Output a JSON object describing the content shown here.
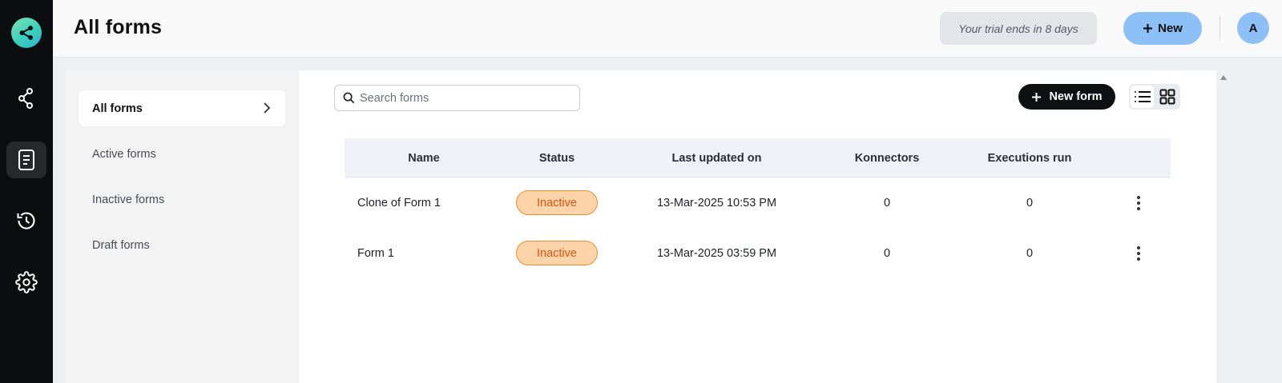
{
  "app": {
    "logo_icon": "share-network-icon"
  },
  "rail": {
    "items": [
      {
        "name": "integrations",
        "icon": "share-network-icon",
        "active": false
      },
      {
        "name": "forms",
        "icon": "document-icon",
        "active": true
      },
      {
        "name": "history",
        "icon": "history-icon",
        "active": false
      },
      {
        "name": "settings",
        "icon": "gear-icon",
        "active": false
      }
    ]
  },
  "header": {
    "title": "All forms",
    "trial_text": "Your trial ends in 8 days",
    "new_label": "New",
    "avatar_initial": "A"
  },
  "subnav": {
    "items": [
      {
        "label": "All forms",
        "active": true
      },
      {
        "label": "Active forms",
        "active": false
      },
      {
        "label": "Inactive forms",
        "active": false
      },
      {
        "label": "Draft forms",
        "active": false
      }
    ]
  },
  "main": {
    "search_placeholder": "Search forms",
    "new_form_label": "New form",
    "view_mode": "list",
    "columns": [
      "Name",
      "Status",
      "Last updated on",
      "Konnectors",
      "Executions run"
    ],
    "rows": [
      {
        "name": "Clone of Form 1",
        "status": "Inactive",
        "updated": "13-Mar-2025 10:53 PM",
        "konnectors": "0",
        "executions": "0"
      },
      {
        "name": "Form 1",
        "status": "Inactive",
        "updated": "13-Mar-2025 03:59 PM",
        "konnectors": "0",
        "executions": "0"
      }
    ]
  },
  "colors": {
    "accent_blue": "#8dc0f7",
    "badge_bg": "#fdd3a9",
    "badge_text": "#d9540f",
    "rail_bg": "#0c0d0f"
  }
}
